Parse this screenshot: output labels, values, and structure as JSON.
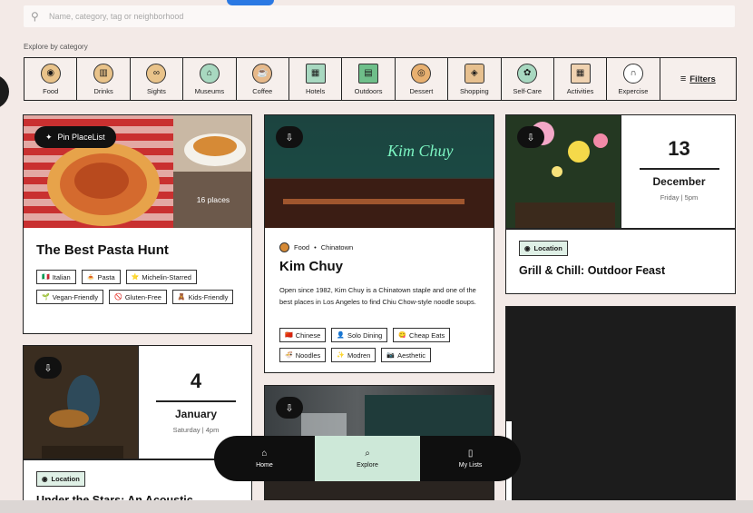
{
  "search": {
    "placeholder": "Name, category, tag or neighborhood",
    "icon": "search-icon"
  },
  "explore": {
    "label": "Explore by category"
  },
  "categories": [
    {
      "label": "Food",
      "icon": "pizza-icon"
    },
    {
      "label": "Drinks",
      "icon": "cup-icon"
    },
    {
      "label": "Sights",
      "icon": "binoculars-icon"
    },
    {
      "label": "Museums",
      "icon": "museum-icon"
    },
    {
      "label": "Coffee",
      "icon": "coffee-icon"
    },
    {
      "label": "Hotels",
      "icon": "hotel-icon"
    },
    {
      "label": "Outdoors",
      "icon": "map-icon"
    },
    {
      "label": "Dessert",
      "icon": "donut-icon"
    },
    {
      "label": "Shopping",
      "icon": "tag-icon"
    },
    {
      "label": "Self-Care",
      "icon": "self-care-icon"
    },
    {
      "label": "Activities",
      "icon": "calendar-icon"
    },
    {
      "label": "Expercise",
      "icon": "kettlebell-icon"
    }
  ],
  "filters": {
    "label": "Filters"
  },
  "placelist": {
    "pin_label": "Pin PlaceList",
    "places": "16 places",
    "title": "The Best Pasta Hunt",
    "tags": [
      {
        "icon": "🇮🇹",
        "label": "Italian"
      },
      {
        "icon": "🍝",
        "label": "Pasta"
      },
      {
        "icon": "⭐",
        "label": "Michelin-Starred"
      },
      {
        "icon": "🌱",
        "label": "Vegan-Friendly"
      },
      {
        "icon": "🚫",
        "label": "Gluten-Free"
      },
      {
        "icon": "🧸",
        "label": "Kids-Friendly"
      }
    ]
  },
  "place": {
    "category": "Food",
    "neighborhood": "Chinatown",
    "title": "Kim Chuy",
    "description": "Open since 1982, Kim Chuy is a Chinatown staple and one of the best places in Los Angeles to find Chiu Chow-style noodle soups.",
    "neon_text": "Kim Chuy",
    "tags": [
      {
        "icon": "🇨🇳",
        "label": "Chinese"
      },
      {
        "icon": "👤",
        "label": "Solo Dining"
      },
      {
        "icon": "😋",
        "label": "Cheap Eats"
      },
      {
        "icon": "🍜",
        "label": "Noodles"
      },
      {
        "icon": "✨",
        "label": "Modren"
      },
      {
        "icon": "📷",
        "label": "Aesthetic"
      }
    ]
  },
  "event1": {
    "day": "13",
    "month": "December",
    "time": "Friday | 5pm",
    "chip": "Location",
    "title": "Grill & Chill: Outdoor Feast"
  },
  "event2": {
    "day": "4",
    "month": "January",
    "time": "Saturday | 4pm",
    "chip": "Location",
    "title": "Under the Stars: An Acoustic"
  },
  "nav": [
    {
      "label": "Home",
      "icon": "home-icon"
    },
    {
      "label": "Explore",
      "icon": "explore-icon"
    },
    {
      "label": "My Lists",
      "icon": "lists-icon"
    }
  ],
  "colors": {
    "accent_green": "#cde8d8",
    "chip_green": "#dff0e6",
    "bg": "#f3eae7",
    "blue": "#2b79e3"
  }
}
